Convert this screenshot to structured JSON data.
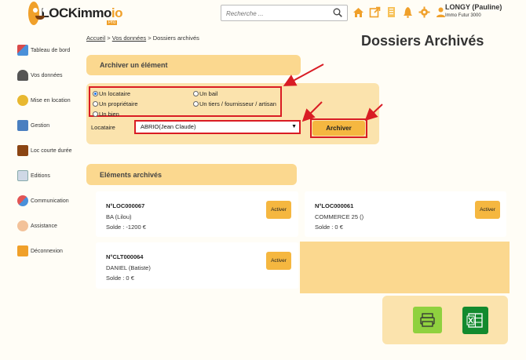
{
  "header": {
    "logo_text": "LOCKimmo",
    "logo_text_accent": "io",
    "logo_badge": "Pro",
    "search_placeholder": "Recherche ...",
    "icons": [
      "home-icon",
      "external-link-icon",
      "document-icon",
      "bell-icon",
      "gear-icon",
      "user-icon"
    ],
    "user_name": "LONGY (Pauline)",
    "company": "Immo Futur 3000"
  },
  "sidebar": {
    "items": [
      {
        "label": "Tableau de bord",
        "icon": "dashboard-icon"
      },
      {
        "label": "Vos données",
        "icon": "person-icon"
      },
      {
        "label": "Mise en location",
        "icon": "key-icon"
      },
      {
        "label": "Gestion",
        "icon": "calculator-icon"
      },
      {
        "label": "Loc courte durée",
        "icon": "suitcase-icon"
      },
      {
        "label": "Editions",
        "icon": "chart-icon"
      },
      {
        "label": "Communication",
        "icon": "chat-icon"
      },
      {
        "label": "Assistance",
        "icon": "support-icon"
      },
      {
        "label": "Déconnexion",
        "icon": "logout-icon"
      }
    ]
  },
  "breadcrumb": {
    "home": "Accueil",
    "sep1": ">",
    "data": "Vos données",
    "sep2": ">",
    "current": "Dossiers archivés"
  },
  "page_title": "Dossiers Archivés",
  "archive": {
    "heading": "Archiver un élément",
    "options": [
      {
        "label": "Un locataire",
        "checked": true
      },
      {
        "label": "Un bail",
        "checked": false
      },
      {
        "label": "Un propriétaire",
        "checked": false
      },
      {
        "label": "Un tiers / fournisseur / artisan",
        "checked": false
      },
      {
        "label": "Un bien",
        "checked": false
      }
    ],
    "select_label": "Locataire",
    "select_value": "ABRIO(Jean Claude)",
    "button": "Archiver"
  },
  "archived": {
    "heading": "Eléments archivés",
    "activate_label": "Activer",
    "cards": [
      {
        "id": "N°LOC000067",
        "name": "BA (Lilou)",
        "solde": "Solde : -1200 €"
      },
      {
        "id": "N°LOC000061",
        "name": "COMMERCE 25 ()",
        "solde": "Solde : 0 €"
      },
      {
        "id": "N°CLT000064",
        "name": "DANIEL (Batiste)",
        "solde": "Solde : 0 €"
      }
    ]
  },
  "colors": {
    "accent": "#f5b740",
    "panel": "#fbd88f",
    "panel_light": "#fbe3ad",
    "highlight": "#d91c24",
    "print": "#8fd13f",
    "excel": "#128a2e"
  }
}
